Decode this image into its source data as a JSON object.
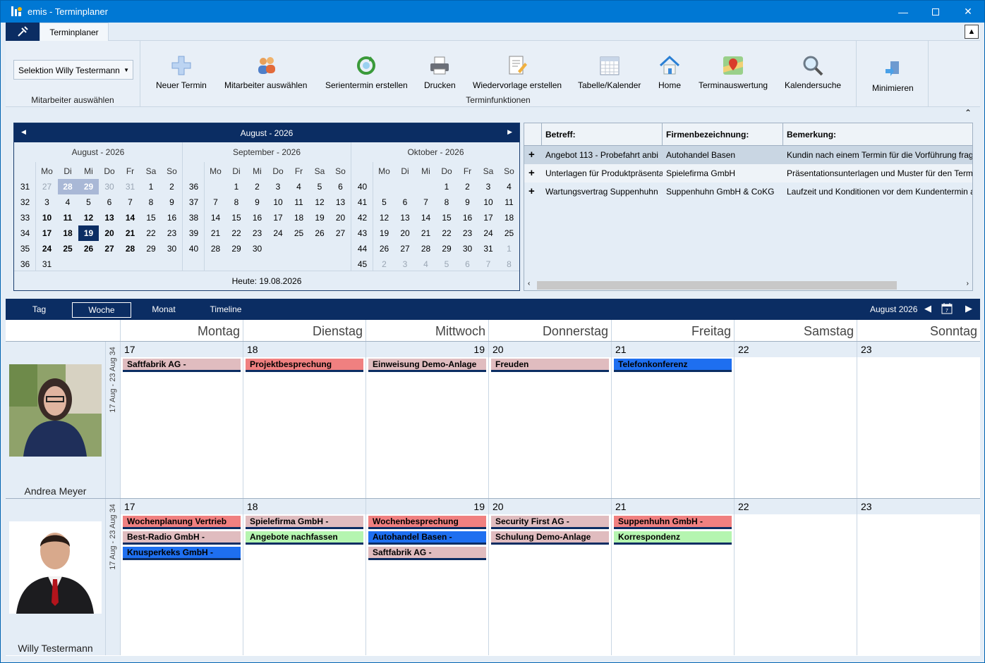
{
  "window": {
    "title": "emis - Terminplaner"
  },
  "ribbon": {
    "tab": "Terminplaner",
    "employee_select": "Selektion Willy Testermann",
    "employee_group": "Mitarbeiter auswählen",
    "functions_group": "Terminfunktionen",
    "buttons": [
      "Neuer Termin",
      "Mitarbeiter auswählen",
      "Serientermin erstellen",
      "Drucken",
      "Wiedervorlage erstellen",
      "Tabelle/Kalender",
      "Home",
      "Terminauswertung",
      "Kalendersuche"
    ],
    "minimize": "Minimieren"
  },
  "calendar": {
    "header": "August - 2026",
    "today": "Heute: 19.08.2026",
    "weekday_headers": [
      "Mo",
      "Di",
      "Mi",
      "Do",
      "Fr",
      "Sa",
      "So"
    ],
    "months": [
      {
        "title": "August - 2026",
        "weeks": [
          "31",
          "32",
          "33",
          "34",
          "35",
          "36"
        ],
        "days": [
          [
            "27",
            "28",
            "29",
            "30",
            "31",
            "1",
            "2"
          ],
          [
            "3",
            "4",
            "5",
            "6",
            "7",
            "8",
            "9"
          ],
          [
            "10",
            "11",
            "12",
            "13",
            "14",
            "15",
            "16"
          ],
          [
            "17",
            "18",
            "19",
            "20",
            "21",
            "22",
            "23"
          ],
          [
            "24",
            "25",
            "26",
            "27",
            "28",
            "29",
            "30"
          ],
          [
            "31",
            "",
            "",
            "",
            "",
            "",
            ""
          ]
        ]
      },
      {
        "title": "September - 2026",
        "weeks": [
          "36",
          "37",
          "38",
          "39",
          "40"
        ],
        "days": [
          [
            "",
            "1",
            "2",
            "3",
            "4",
            "5",
            "6"
          ],
          [
            "7",
            "8",
            "9",
            "10",
            "11",
            "12",
            "13"
          ],
          [
            "14",
            "15",
            "16",
            "17",
            "18",
            "19",
            "20"
          ],
          [
            "21",
            "22",
            "23",
            "24",
            "25",
            "26",
            "27"
          ],
          [
            "28",
            "29",
            "30",
            "",
            "",
            "",
            ""
          ]
        ]
      },
      {
        "title": "Oktober - 2026",
        "weeks": [
          "40",
          "41",
          "42",
          "43",
          "44",
          "45"
        ],
        "days": [
          [
            "",
            "",
            "",
            "1",
            "2",
            "3",
            "4"
          ],
          [
            "5",
            "6",
            "7",
            "8",
            "9",
            "10",
            "11"
          ],
          [
            "12",
            "13",
            "14",
            "15",
            "16",
            "17",
            "18"
          ],
          [
            "19",
            "20",
            "21",
            "22",
            "23",
            "24",
            "25"
          ],
          [
            "26",
            "27",
            "28",
            "29",
            "30",
            "31",
            "1"
          ],
          [
            "2",
            "3",
            "4",
            "5",
            "6",
            "7",
            "8"
          ]
        ]
      }
    ]
  },
  "grid": {
    "columns": [
      "Betreff:",
      "Firmenbezeichnung:",
      "Bemerkung:"
    ],
    "rows": [
      [
        "Angebot 113 - Probefahrt anbi",
        "Autohandel Basen",
        "Kundin nach einem Termin für die Vorführung frag"
      ],
      [
        "Unterlagen für Produktpräsentati",
        "Spielefirma GmbH",
        "Präsentationsunterlagen und Muster für den Term"
      ],
      [
        "Wartungsvertrag Suppenhuhn",
        "Suppenhuhn GmbH & CoKG",
        "Laufzeit und Konditionen vor dem Kundentermin a"
      ]
    ]
  },
  "views": {
    "tabs": [
      "Tag",
      "Woche",
      "Monat",
      "Timeline"
    ],
    "active": "Woche",
    "month_label": "August 2026"
  },
  "schedule": {
    "days": [
      "Montag",
      "Dienstag",
      "Mittwoch",
      "Donnerstag",
      "Freitag",
      "Samstag",
      "Sonntag"
    ],
    "dates": [
      "17",
      "18",
      "19",
      "20",
      "21",
      "22",
      "23"
    ],
    "week_label": "17 Aug - 23 Aug 34",
    "resources": [
      {
        "name": "Andrea Meyer",
        "events": [
          [
            {
              "t": "Saftfabrik AG -",
              "c": "pink"
            }
          ],
          [
            {
              "t": "Projektbesprechung",
              "c": "red"
            }
          ],
          [
            {
              "t": "Einweisung Demo-Anlage",
              "c": "pink"
            }
          ],
          [
            {
              "t": "Freuden",
              "c": "pink"
            }
          ],
          [
            {
              "t": "Telefonkonferenz",
              "c": "blue"
            }
          ],
          [],
          []
        ]
      },
      {
        "name": "Willy Testermann",
        "events": [
          [
            {
              "t": "Wochenplanung Vertrieb",
              "c": "red"
            },
            {
              "t": "Best-Radio GmbH -",
              "c": "pink"
            },
            {
              "t": "Knusperkeks GmbH -",
              "c": "blue"
            }
          ],
          [
            {
              "t": "Spielefirma GmbH -",
              "c": "pink"
            },
            {
              "t": "Angebote nachfassen",
              "c": "green"
            }
          ],
          [
            {
              "t": "Wochenbesprechung",
              "c": "red"
            },
            {
              "t": "Autohandel Basen -",
              "c": "blue"
            },
            {
              "t": "Saftfabrik AG -",
              "c": "pink"
            }
          ],
          [
            {
              "t": "Security First AG -",
              "c": "pink"
            },
            {
              "t": "Schulung Demo-Anlage",
              "c": "pink"
            }
          ],
          [
            {
              "t": "Suppenhuhn GmbH -",
              "c": "red"
            },
            {
              "t": "Korrespondenz",
              "c": "green"
            }
          ],
          [],
          []
        ]
      }
    ]
  }
}
